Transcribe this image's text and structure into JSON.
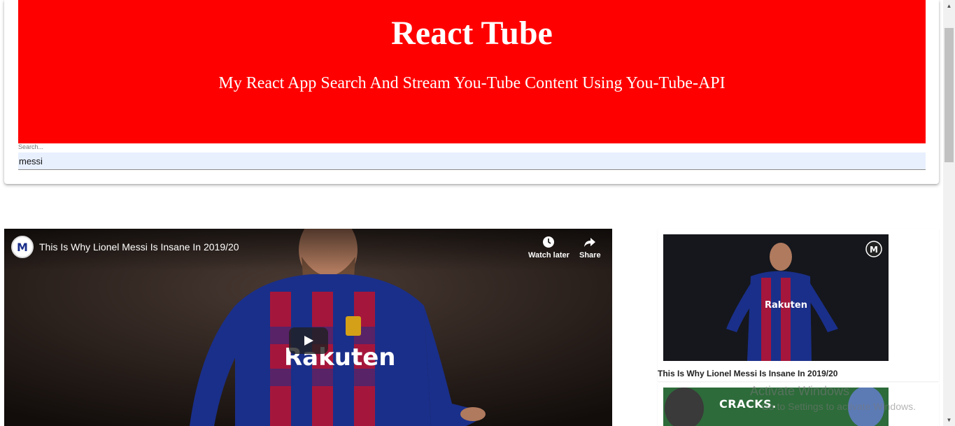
{
  "header": {
    "title": "React Tube",
    "subtitle": "My React App Search And Stream You-Tube Content Using You-Tube-API"
  },
  "search": {
    "label": "Search...",
    "value": "messi"
  },
  "player": {
    "title": "This Is Why Lionel Messi Is Insane In 2019/20",
    "watch_later_label": "Watch later",
    "share_label": "Share",
    "channel_logo_letter": "M"
  },
  "video_list": [
    {
      "title": "This Is Why Lionel Messi Is Insane In 2019/20"
    },
    {
      "title": "",
      "thumb_text": "CRACKS."
    }
  ],
  "watermark": {
    "line1": "Activate Windows",
    "line2": "Go to Settings to activate Windows."
  },
  "colors": {
    "brand_red": "#ff0000",
    "search_bg": "#e8f0fe"
  }
}
